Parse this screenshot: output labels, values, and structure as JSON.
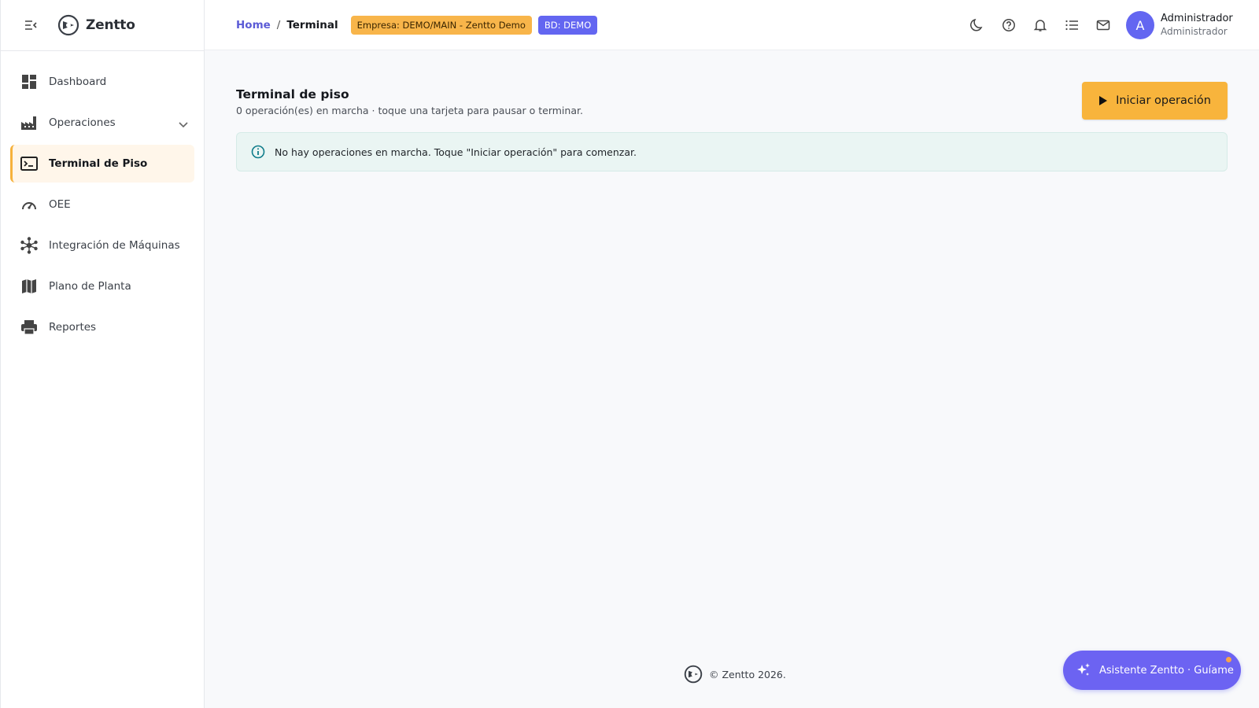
{
  "app": {
    "brand": "Zentto"
  },
  "sidebar": {
    "items": [
      {
        "label": "Dashboard",
        "icon": "dashboard-icon"
      },
      {
        "label": "Operaciones",
        "icon": "factory-icon",
        "expandable": true
      },
      {
        "label": "Terminal de Piso",
        "icon": "terminal-icon",
        "active": true
      },
      {
        "label": "OEE",
        "icon": "gauge-icon"
      },
      {
        "label": "Integración de Máquinas",
        "icon": "hub-icon"
      },
      {
        "label": "Plano de Planta",
        "icon": "map-icon"
      },
      {
        "label": "Reportes",
        "icon": "printer-icon"
      }
    ]
  },
  "breadcrumb": {
    "home": "Home",
    "separator": "/",
    "current": "Terminal"
  },
  "badges": {
    "company": "Empresa: DEMO/MAIN - Zentto Demo",
    "db": "BD: DEMO"
  },
  "topbar": {
    "icons": [
      "moon-icon",
      "help-icon",
      "bell-icon",
      "list-icon",
      "mail-icon"
    ]
  },
  "user": {
    "initial": "A",
    "name": "Administrador",
    "role": "Administrador"
  },
  "page": {
    "title": "Terminal de piso",
    "subtitle": "0 operación(es) en marcha · toque una tarjeta para pausar o terminar.",
    "start_button": "Iniciar operación",
    "info_alert": "No hay operaciones en marcha. Toque \"Iniciar operación\" para comenzar."
  },
  "footer": {
    "copyright": "© Zentto 2026."
  },
  "assistant": {
    "label": "Asistente Zentto · Guíame"
  },
  "colors": {
    "accent": "#f8b43c",
    "primary": "#6366f1",
    "info_bg": "#eaf5f3"
  }
}
